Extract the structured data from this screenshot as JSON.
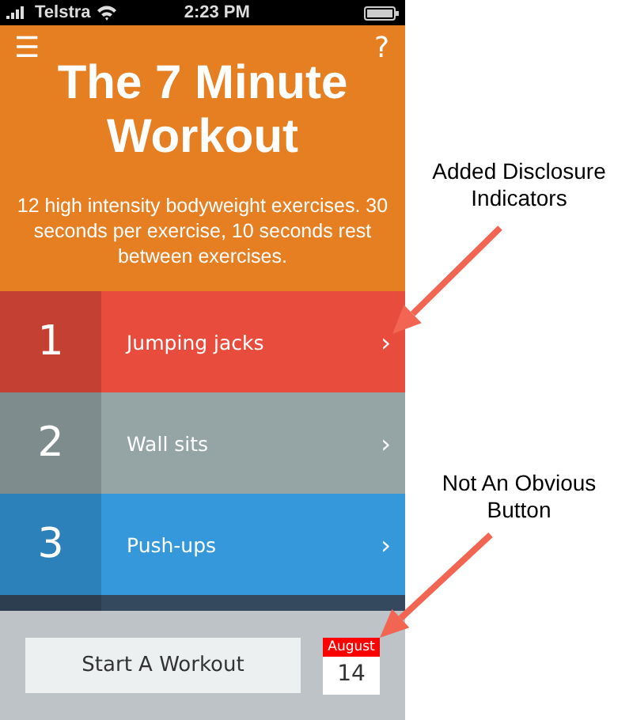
{
  "status_bar": {
    "carrier": "Telstra",
    "time": "2:23 PM"
  },
  "header": {
    "menu_glyph": "☰",
    "help_glyph": "?",
    "title": "The 7 Minute Workout",
    "description": "12 high intensity bodyweight exercises. 30 seconds per exercise, 10 seconds rest between exercises."
  },
  "exercises": [
    {
      "number": "1",
      "name": "Jumping jacks",
      "chevron": "›",
      "color": "#e74c3c"
    },
    {
      "number": "2",
      "name": "Wall sits",
      "chevron": "›",
      "color": "#95a5a6"
    },
    {
      "number": "3",
      "name": "Push-ups",
      "chevron": "›",
      "color": "#3498db"
    },
    {
      "color": "#34495e"
    }
  ],
  "footer": {
    "start_button": "Start A Workout",
    "calendar": {
      "month": "August",
      "day": "14"
    }
  },
  "annotations": [
    {
      "text": "Added Disclosure Indicators"
    },
    {
      "text": "Not An Obvious Button"
    }
  ]
}
